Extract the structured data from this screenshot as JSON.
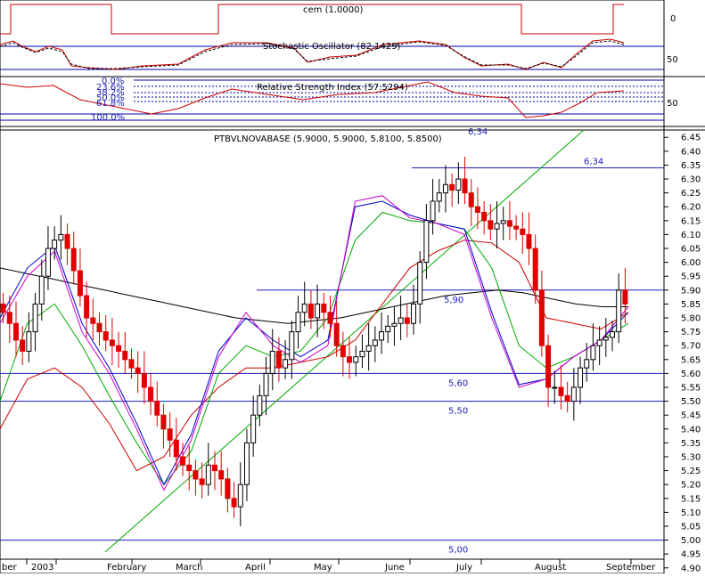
{
  "panels": {
    "cem": {
      "title": "cem (1.0000)",
      "yticks": [
        "0",
        "50"
      ]
    },
    "stochastic": {
      "title": "Stochastic Oscillator (82.1429)",
      "yticks": [
        "50"
      ]
    },
    "rsi": {
      "title": "Relative Strength Index (57.5294)",
      "yticks": [
        "50"
      ],
      "fib_levels": [
        "0.0%",
        "23.6%",
        "38.2%",
        "50.0%",
        "61.8%",
        "100.0%"
      ]
    }
  },
  "chart_data": {
    "type": "candlestick",
    "title": "PTBVLNOVABASE (5.9000, 5.9000, 5.8100, 5.8500)",
    "ylim": [
      4.88,
      6.47
    ],
    "y_ticks": [
      "6.45",
      "6.40",
      "6.35",
      "6.30",
      "6.25",
      "6.20",
      "6.15",
      "6.10",
      "6.05",
      "6.00",
      "5.95",
      "5.90",
      "5.85",
      "5.80",
      "5.75",
      "5.70",
      "5.65",
      "5.60",
      "5.55",
      "5.50",
      "5.45",
      "5.40",
      "5.35",
      "5.30",
      "5.25",
      "5.20",
      "5.15",
      "5.10",
      "5.05",
      "5.00",
      "4.95",
      "4.90"
    ],
    "x_labels": [
      "ber",
      "2003",
      "February",
      "March",
      "April",
      "May",
      "June",
      "July",
      "August",
      "September"
    ],
    "horizontal_lines": [
      {
        "value": 6.34,
        "label": "6,34"
      },
      {
        "value": 5.9,
        "label": "5,90"
      },
      {
        "value": 5.6,
        "label": "5,60"
      },
      {
        "value": 5.5,
        "label": "5,50"
      },
      {
        "value": 5.0,
        "label": "5,00"
      }
    ],
    "top_label": "6,34",
    "close": [
      5.82,
      5.78,
      5.72,
      5.68,
      5.75,
      5.85,
      5.95,
      6.05,
      6.08,
      6.1,
      6.05,
      5.97,
      5.88,
      5.8,
      5.78,
      5.75,
      5.72,
      5.7,
      5.68,
      5.65,
      5.62,
      5.6,
      5.55,
      5.5,
      5.45,
      5.4,
      5.36,
      5.3,
      5.27,
      5.25,
      5.22,
      5.2,
      5.27,
      5.25,
      5.22,
      5.15,
      5.12,
      5.2,
      5.35,
      5.45,
      5.52,
      5.6,
      5.68,
      5.62,
      5.65,
      5.75,
      5.82,
      5.85,
      5.8,
      5.85,
      5.82,
      5.78,
      5.7,
      5.66,
      5.64,
      5.66,
      5.68,
      5.7,
      5.72,
      5.75,
      5.77,
      5.78,
      5.8,
      5.78,
      5.85,
      6.0,
      6.15,
      6.22,
      6.25,
      6.28,
      6.26,
      6.3,
      6.25,
      6.2,
      6.18,
      6.15,
      6.12,
      6.14,
      6.15,
      6.13,
      6.12,
      6.1,
      6.05,
      5.9,
      5.7,
      5.55,
      5.55,
      5.52,
      5.5,
      5.55,
      5.62,
      5.65,
      5.7,
      5.72,
      5.73,
      5.75,
      5.9,
      5.85
    ],
    "series": [
      {
        "color": "#000000",
        "values": [
          5.98,
          5.96,
          5.94,
          5.92,
          5.9,
          5.88,
          5.86,
          5.84,
          5.82,
          5.8,
          5.79,
          5.78,
          5.79,
          5.8,
          5.82,
          5.84,
          5.86,
          5.88,
          5.89,
          5.9,
          5.89,
          5.87,
          5.85,
          5.84,
          5.84
        ]
      },
      {
        "color": "#cc0000",
        "values": [
          5.4,
          5.58,
          5.62,
          5.55,
          5.42,
          5.25,
          5.3,
          5.45,
          5.55,
          5.62,
          5.62,
          5.64,
          5.66,
          5.72,
          5.85,
          5.98,
          6.04,
          6.08,
          6.07,
          6.0,
          5.8,
          5.78,
          5.76,
          5.82
        ]
      },
      {
        "color": "#00aa00",
        "values": [
          5.5,
          5.78,
          5.85,
          5.7,
          5.52,
          5.35,
          5.2,
          5.32,
          5.6,
          5.7,
          5.66,
          5.68,
          5.8,
          6.08,
          6.18,
          6.15,
          6.14,
          6.12,
          5.98,
          5.7,
          5.62,
          5.66,
          5.72,
          5.78
        ]
      },
      {
        "color": "#0000cc",
        "values": [
          5.8,
          5.98,
          6.06,
          5.78,
          5.62,
          5.42,
          5.2,
          5.38,
          5.68,
          5.8,
          5.72,
          5.66,
          5.72,
          6.2,
          6.22,
          6.17,
          6.14,
          6.12,
          5.82,
          5.56,
          5.58,
          5.66,
          5.72,
          5.82
        ]
      },
      {
        "color": "#cc00cc",
        "values": [
          5.78,
          5.95,
          6.04,
          5.75,
          5.6,
          5.4,
          5.18,
          5.36,
          5.66,
          5.82,
          5.7,
          5.64,
          5.7,
          6.22,
          6.24,
          6.16,
          6.14,
          6.1,
          5.8,
          5.55,
          5.58,
          5.66,
          5.72,
          5.84
        ]
      }
    ],
    "trendline": {
      "from": [
        0,
        4.88
      ],
      "to": [
        1,
        6.47
      ],
      "color": "#00aa00"
    }
  }
}
